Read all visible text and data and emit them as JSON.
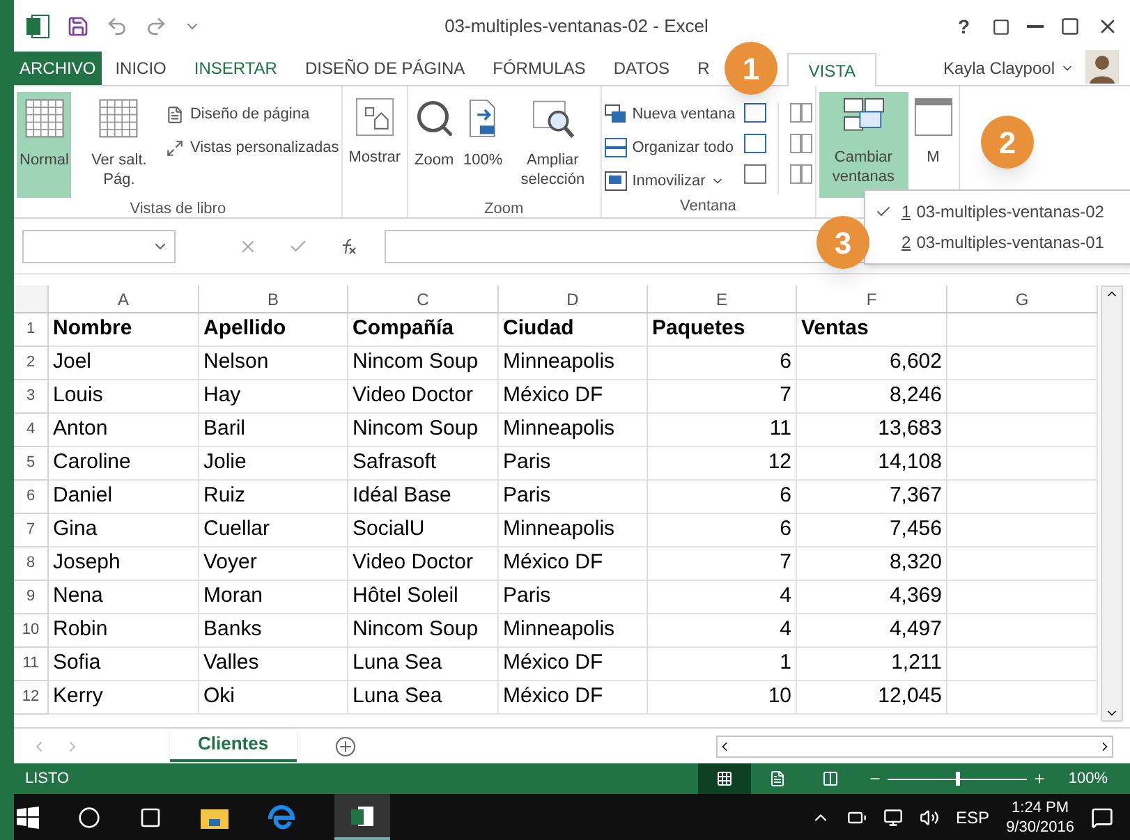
{
  "window": {
    "title": "03-multiples-ventanas-02 - Excel",
    "help": "?"
  },
  "tabs": [
    {
      "label": "ARCHIVO",
      "kind": "file",
      "selected": false
    },
    {
      "label": "INICIO",
      "kind": "tab",
      "selected": false
    },
    {
      "label": "INSERTAR",
      "kind": "accent",
      "selected": false
    },
    {
      "label": "DISEÑO DE PÁGINA",
      "kind": "tab",
      "selected": false
    },
    {
      "label": "FÓRMULAS",
      "kind": "tab",
      "selected": false
    },
    {
      "label": "DATOS",
      "kind": "tab",
      "selected": false
    },
    {
      "label": "R",
      "kind": "tab",
      "selected": false
    },
    {
      "label": "VISTA",
      "kind": "tab",
      "selected": true
    }
  ],
  "user": {
    "name": "Kayla Claypool"
  },
  "ribbon": {
    "groups": [
      {
        "label": "Vistas de libro",
        "large": [
          {
            "label": "Normal",
            "selected": true
          },
          {
            "label": "Ver salt. Pág.",
            "selected": false
          }
        ],
        "small": [
          "Diseño de página",
          "Vistas personalizadas"
        ]
      },
      {
        "large": [
          {
            "label": "Mostrar",
            "selected": false
          }
        ]
      },
      {
        "label": "Zoom",
        "large": [
          {
            "label": "Zoom",
            "selected": false
          },
          {
            "label": "100%",
            "selected": false
          },
          {
            "label": "Ampliar selección",
            "selected": false
          }
        ]
      },
      {
        "label": "Ventana",
        "small": [
          "Nueva ventana",
          "Organizar todo",
          "Inmovilizar"
        ]
      },
      {
        "large": [
          {
            "label": "Cambiar ventanas",
            "selected": true
          },
          {
            "label": "M",
            "selected": false
          }
        ]
      }
    ]
  },
  "window_menu": [
    {
      "key": "1",
      "label": "03-multiples-ventanas-02",
      "checked": true
    },
    {
      "key": "2",
      "label": "03-multiples-ventanas-01",
      "checked": false
    }
  ],
  "callouts": [
    "1",
    "2",
    "3"
  ],
  "table": {
    "columns": [
      "A",
      "B",
      "C",
      "D",
      "E",
      "F",
      "G"
    ],
    "rows": [
      {
        "number": "1",
        "cells": [
          "Nombre",
          "Apellido",
          "Compañía",
          "Ciudad",
          "Paquetes",
          "Ventas"
        ]
      },
      {
        "number": "2",
        "cells": [
          "Joel",
          "Nelson",
          "Nincom Soup",
          "Minneapolis",
          "6",
          "6,602"
        ]
      },
      {
        "number": "3",
        "cells": [
          "Louis",
          "Hay",
          "Video Doctor",
          "México DF",
          "7",
          "8,246"
        ]
      },
      {
        "number": "4",
        "cells": [
          "Anton",
          "Baril",
          "Nincom Soup",
          "Minneapolis",
          "11",
          "13,683"
        ]
      },
      {
        "number": "5",
        "cells": [
          "Caroline",
          "Jolie",
          "Safrasoft",
          "Paris",
          "12",
          "14,108"
        ]
      },
      {
        "number": "6",
        "cells": [
          "Daniel",
          "Ruiz",
          "Idéal Base",
          "Paris",
          "6",
          "7,367"
        ]
      },
      {
        "number": "7",
        "cells": [
          "Gina",
          "Cuellar",
          "SocialU",
          "Minneapolis",
          "6",
          "7,456"
        ]
      },
      {
        "number": "8",
        "cells": [
          "Joseph",
          "Voyer",
          "Video Doctor",
          "México DF",
          "7",
          "8,320"
        ]
      },
      {
        "number": "9",
        "cells": [
          "Nena",
          "Moran",
          "Hôtel Soleil",
          "Paris",
          "4",
          "4,369"
        ]
      },
      {
        "number": "10",
        "cells": [
          "Robin",
          "Banks",
          "Nincom Soup",
          "Minneapolis",
          "4",
          "4,497"
        ]
      },
      {
        "number": "11",
        "cells": [
          "Sofia",
          "Valles",
          "Luna Sea",
          "México DF",
          "1",
          "1,211"
        ]
      },
      {
        "number": "12",
        "cells": [
          "Kerry",
          "Oki",
          "Luna Sea",
          "México DF",
          "10",
          "12,045"
        ]
      }
    ]
  },
  "sheets": [
    {
      "label": "Clientes",
      "selected": true
    }
  ],
  "status_bar": {
    "text": "LISTO",
    "views": [
      {
        "selected": true
      },
      {
        "selected": false
      },
      {
        "selected": false
      }
    ],
    "zoom": {
      "level": 0.5,
      "reading": "100%"
    }
  },
  "taskbar": {
    "language": "ESP",
    "time": "1:24 PM",
    "date": "9/30/2016"
  }
}
